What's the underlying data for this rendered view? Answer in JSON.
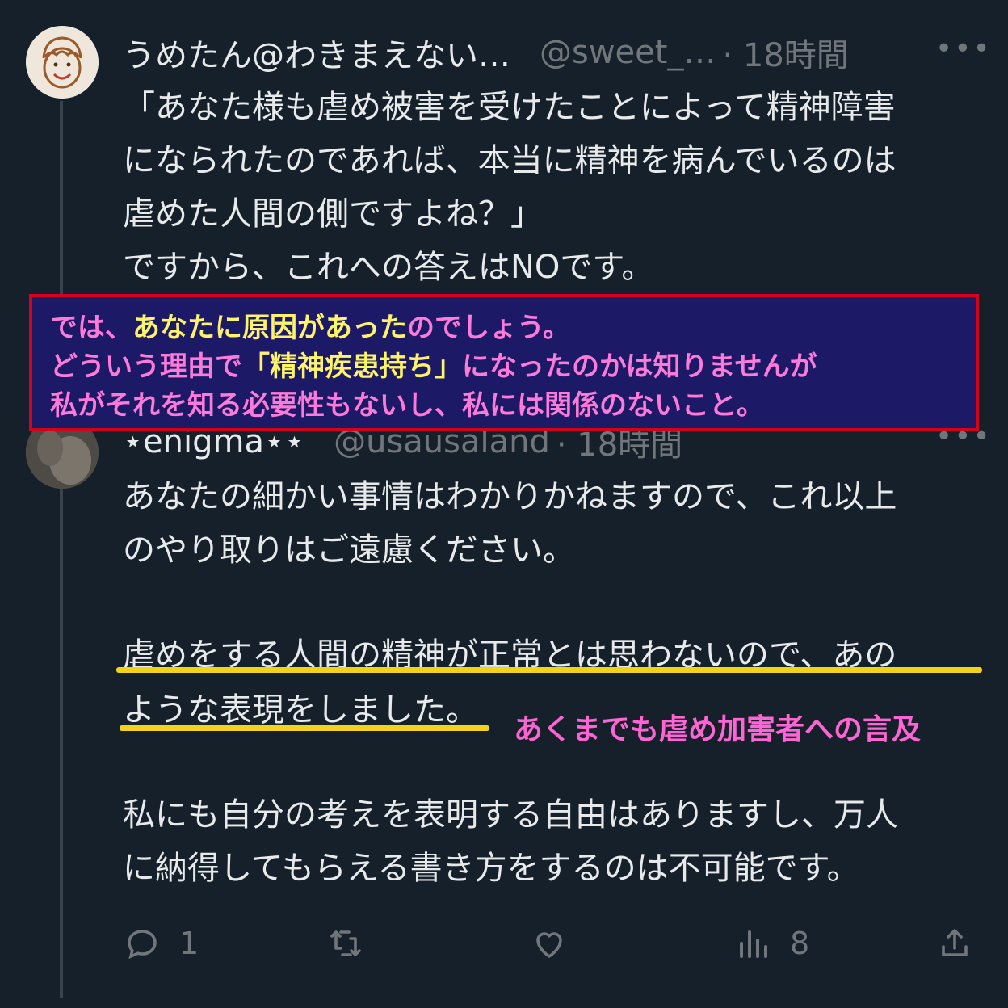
{
  "tweet1": {
    "display_name": "うめたん@わきまえない…",
    "handle": "@sweet_…",
    "time": "· 18時間",
    "more": "•••",
    "lines": [
      "「あなた様も虐め被害を受けたことによって精神障害",
      "になられたのであれば、本当に精神を病んでいるのは",
      "虐めた人間の側ですよね？」",
      "ですから、これへの答えはNOです。"
    ]
  },
  "overlay": {
    "line1_pink_a": "では、",
    "line1_yellow": "あなたに原因があった",
    "line1_pink_b": "のでしょう。",
    "line2_pink_a": "どういう理由で",
    "line2_yellow": "「精神疾患持ち」",
    "line2_pink_b": "になったのかは知りませんが",
    "line3": "私がそれを知る必要性もないし、私には関係のないこと。"
  },
  "tweet2": {
    "display_name": "⋆enigma⋆⋆",
    "handle": "@usausaland",
    "time": "· 18時間",
    "more": "•••",
    "para1": [
      "あなたの細かい事情はわかりかねますので、これ以上",
      "のやり取りはご遠慮ください。"
    ],
    "para2": [
      "虐めをする人間の精神が正常とは思わないので、あの",
      "ような表現をしました。"
    ],
    "para3": [
      "私にも自分の考えを表明する自由はありますし、万人",
      "に納得してもらえる書き方をするのは不可能です。"
    ]
  },
  "annotation": "あくまでも虐め加害者への言及",
  "actions": {
    "reply_count": "1",
    "retweet_count": "",
    "like_count": "",
    "views_count": "8"
  },
  "colors": {
    "background": "#15202b",
    "text": "#e7e9ea",
    "muted": "#71767b",
    "highlight_underline": "#f2d21b",
    "annotation": "#ff66d4"
  }
}
